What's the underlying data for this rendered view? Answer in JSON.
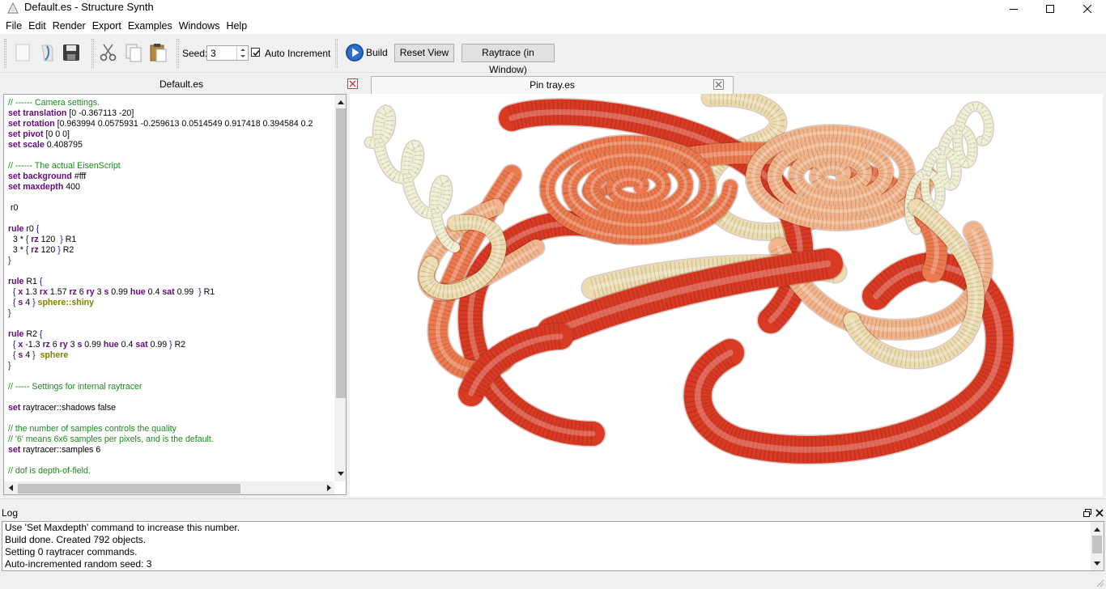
{
  "window": {
    "title": "Default.es - Structure Synth",
    "icons": {
      "app": "triangle-app-icon",
      "minimize": "minimize-icon",
      "maximize": "maximize-icon",
      "close": "close-icon"
    }
  },
  "menubar": [
    "File",
    "Edit",
    "Render",
    "Export",
    "Examples",
    "Windows",
    "Help"
  ],
  "toolbar": {
    "seed_label": "Seed:",
    "seed_value": "3",
    "auto_increment_label": "Auto Increment",
    "auto_increment_checked": true,
    "build_label": "Build",
    "reset_view_label": "Reset View",
    "raytrace_label": "Raytrace (in Window)"
  },
  "editor": {
    "tab_label": "Default.es",
    "lines": [
      [
        {
          "t": "// ------ Camera settings.",
          "c": "com"
        }
      ],
      [
        {
          "t": "set translation",
          "c": "kw"
        },
        {
          "t": " [0 -0.367113 -20]",
          "c": "tx"
        }
      ],
      [
        {
          "t": "set rotation",
          "c": "kw"
        },
        {
          "t": " [0.963994 0.0575931 -0.259613 0.0514549 0.917418 0.394584 0.2",
          "c": "tx"
        }
      ],
      [
        {
          "t": "set pivot",
          "c": "kw"
        },
        {
          "t": " [0 0 0]",
          "c": "tx"
        }
      ],
      [
        {
          "t": "set scale",
          "c": "kw"
        },
        {
          "t": " 0.408795",
          "c": "tx"
        }
      ],
      [],
      [
        {
          "t": "// ------ The actual EisenScript",
          "c": "com"
        }
      ],
      [
        {
          "t": "set background",
          "c": "kw"
        },
        {
          "t": " #fff",
          "c": "tx"
        }
      ],
      [
        {
          "t": "set maxdepth",
          "c": "kw"
        },
        {
          "t": " 400",
          "c": "tx"
        }
      ],
      [],
      [
        {
          "t": " r0",
          "c": "tx"
        }
      ],
      [],
      [
        {
          "t": "rule",
          "c": "kw"
        },
        {
          "t": " r0 ",
          "c": "tx"
        },
        {
          "t": "{",
          "c": "br"
        }
      ],
      [
        {
          "t": "  3 * ",
          "c": "tx"
        },
        {
          "t": "{ ",
          "c": "br"
        },
        {
          "t": "rz",
          "c": "kw"
        },
        {
          "t": " 120  ",
          "c": "tx"
        },
        {
          "t": "}",
          "c": "br"
        },
        {
          "t": " R1",
          "c": "tx"
        }
      ],
      [
        {
          "t": "  3 * ",
          "c": "tx"
        },
        {
          "t": "{ ",
          "c": "br"
        },
        {
          "t": "rz",
          "c": "kw"
        },
        {
          "t": " 120 ",
          "c": "tx"
        },
        {
          "t": "}",
          "c": "br"
        },
        {
          "t": " R2",
          "c": "tx"
        }
      ],
      [
        {
          "t": "}",
          "c": "br"
        }
      ],
      [],
      [
        {
          "t": "rule",
          "c": "kw"
        },
        {
          "t": " R1 ",
          "c": "tx"
        },
        {
          "t": "{",
          "c": "br"
        }
      ],
      [
        {
          "t": "  { ",
          "c": "br"
        },
        {
          "t": "x",
          "c": "kw"
        },
        {
          "t": " 1.3 ",
          "c": "tx"
        },
        {
          "t": "rx",
          "c": "kw"
        },
        {
          "t": " 1.57 ",
          "c": "tx"
        },
        {
          "t": "rz",
          "c": "kw"
        },
        {
          "t": " 6 ",
          "c": "tx"
        },
        {
          "t": "ry",
          "c": "kw"
        },
        {
          "t": " 3 ",
          "c": "tx"
        },
        {
          "t": "s",
          "c": "kw"
        },
        {
          "t": " 0.99 ",
          "c": "tx"
        },
        {
          "t": "hue",
          "c": "kw"
        },
        {
          "t": " 0.4 ",
          "c": "tx"
        },
        {
          "t": "sat",
          "c": "kw"
        },
        {
          "t": " 0.99  ",
          "c": "tx"
        },
        {
          "t": "}",
          "c": "br"
        },
        {
          "t": " R1",
          "c": "tx"
        }
      ],
      [
        {
          "t": "  { ",
          "c": "br"
        },
        {
          "t": "s",
          "c": "kw"
        },
        {
          "t": " 4 ",
          "c": "tx"
        },
        {
          "t": "} ",
          "c": "br"
        },
        {
          "t": "sphere::shiny",
          "c": "prim"
        }
      ],
      [
        {
          "t": "}",
          "c": "br"
        }
      ],
      [],
      [
        {
          "t": "rule",
          "c": "kw"
        },
        {
          "t": " R2 ",
          "c": "tx"
        },
        {
          "t": "{",
          "c": "br"
        }
      ],
      [
        {
          "t": "  { ",
          "c": "br"
        },
        {
          "t": "x",
          "c": "kw"
        },
        {
          "t": " -1.3 ",
          "c": "tx"
        },
        {
          "t": "rz",
          "c": "kw"
        },
        {
          "t": " 6 ",
          "c": "tx"
        },
        {
          "t": "ry",
          "c": "kw"
        },
        {
          "t": " 3 ",
          "c": "tx"
        },
        {
          "t": "s",
          "c": "kw"
        },
        {
          "t": " 0.99 ",
          "c": "tx"
        },
        {
          "t": "hue",
          "c": "kw"
        },
        {
          "t": " 0.4 ",
          "c": "tx"
        },
        {
          "t": "sat",
          "c": "kw"
        },
        {
          "t": " 0.99 ",
          "c": "tx"
        },
        {
          "t": "}",
          "c": "br"
        },
        {
          "t": " R2",
          "c": "tx"
        }
      ],
      [
        {
          "t": "  { ",
          "c": "br"
        },
        {
          "t": "s",
          "c": "kw"
        },
        {
          "t": " 4 ",
          "c": "tx"
        },
        {
          "t": "}  ",
          "c": "br"
        },
        {
          "t": "sphere",
          "c": "prim"
        }
      ],
      [
        {
          "t": "}",
          "c": "br"
        }
      ],
      [],
      [
        {
          "t": "// ----- Settings for internal raytracer",
          "c": "com"
        }
      ],
      [],
      [
        {
          "t": "set",
          "c": "kw"
        },
        {
          "t": " raytracer::shadows false",
          "c": "tx"
        }
      ],
      [],
      [
        {
          "t": "// the number of samples controls the quality",
          "c": "com"
        }
      ],
      [
        {
          "t": "// '6' means 6x6 samples per pixels, and is the default.",
          "c": "com"
        }
      ],
      [
        {
          "t": "set",
          "c": "kw"
        },
        {
          "t": " raytracer::samples 6",
          "c": "tx"
        }
      ],
      [],
      [
        {
          "t": "// dof is depth-of-field.",
          "c": "com"
        }
      ]
    ]
  },
  "viewport": {
    "tab_label": "Pin tray.es",
    "background": "#ffffff",
    "palette": {
      "deep_red": "#d93a24",
      "orange": "#ec7a4e",
      "peach": "#f2b48a",
      "cream": "#ecdcb0",
      "pale": "#efefd2"
    }
  },
  "log": {
    "header": "Log",
    "lines": [
      "Use 'Set Maxdepth' command to increase this number.",
      "Build done. Created 792 objects.",
      "Setting 0 raytracer commands.",
      "Auto-incremented random seed: 3"
    ]
  }
}
